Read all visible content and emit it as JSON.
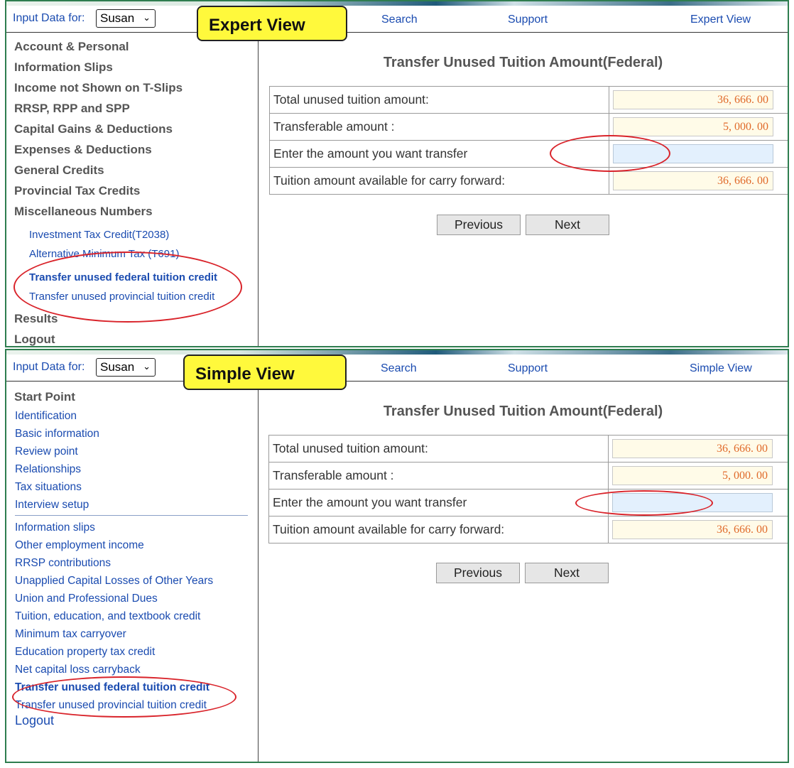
{
  "expert": {
    "badge": "Expert View",
    "topbar": {
      "input_label": "Input Data for:",
      "person": "Susan",
      "search": "Search",
      "support": "Support",
      "view_link": "Expert View"
    },
    "sidebar": {
      "categories": [
        "Account & Personal",
        "Information Slips",
        "Income not Shown on T-Slips",
        "RRSP, RPP and SPP",
        "Capital Gains & Deductions",
        "Expenses & Deductions",
        "General Credits",
        "Provincial Tax Credits",
        "Miscellaneous Numbers"
      ],
      "sub_items": [
        "Investment Tax Credit(T2038)",
        "Alternative Minimum Tax (T691)",
        "Transfer unused federal tuition credit",
        "Transfer unused provincial tuition credit"
      ],
      "active_index": 2,
      "bottom": [
        "Results",
        "Logout"
      ]
    },
    "form": {
      "title": "Transfer Unused Tuition Amount(Federal)",
      "rows": [
        {
          "label": "Total unused tuition amount:",
          "value": "36, 666. 00"
        },
        {
          "label": "Transferable amount :",
          "value": "5, 000. 00"
        },
        {
          "label": "Enter the amount you want transfer",
          "value": ""
        },
        {
          "label": "Tuition amount available for carry forward:",
          "value": "36, 666. 00"
        }
      ],
      "previous": "Previous",
      "next": "Next"
    }
  },
  "simple": {
    "badge": "Simple View",
    "topbar": {
      "input_label": "Input Data for:",
      "person": "Susan",
      "search": "Search",
      "support": "Support",
      "view_link": "Simple View"
    },
    "sidebar": {
      "heading": "Start Point",
      "group1": [
        "Identification",
        "Basic information",
        "Review point",
        "Relationships",
        "Tax situations",
        "Interview setup"
      ],
      "group2": [
        "Information slips",
        "Other employment income",
        "RRSP contributions",
        "Unapplied Capital Losses of Other Years",
        "Union and Professional Dues",
        "Tuition, education, and textbook credit",
        "Minimum tax carryover",
        "Education property tax credit",
        "Net capital loss carryback",
        "Transfer unused federal tuition credit",
        "Transfer unused provincial tuition credit"
      ],
      "active_index": 9,
      "logout": "Logout"
    },
    "form": {
      "title": "Transfer Unused Tuition Amount(Federal)",
      "rows": [
        {
          "label": "Total unused tuition amount:",
          "value": "36, 666. 00"
        },
        {
          "label": "Transferable amount :",
          "value": "5, 000. 00"
        },
        {
          "label": "Enter the amount you want transfer",
          "value": ""
        },
        {
          "label": "Tuition amount available for carry forward:",
          "value": "36, 666. 00"
        }
      ],
      "previous": "Previous",
      "next": "Next"
    }
  },
  "colors": {
    "link": "#1a4bb0",
    "badge": "#fff93c",
    "highlight_ring": "#d9232a",
    "panel_border": "#2e7d4f",
    "amount_text": "#e06a2a"
  }
}
